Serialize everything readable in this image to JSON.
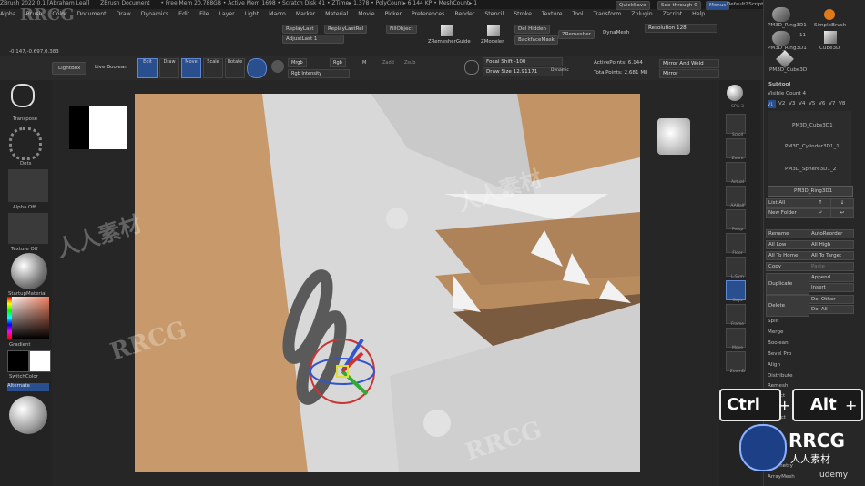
{
  "titlebar": {
    "app": "ZBrush 2022.0.1 [Abraham Leal]",
    "doc": "ZBrush Document",
    "stats": "• Free Mem 20.788GB • Active Mem 1698 • Scratch Disk 41 • ZTime▸ 1.378 • PolyCount▸ 6.144 KP • MeshCount▸ 1",
    "quicksave": "QuickSave",
    "seethrough": "See-through  0",
    "menus_label": "Menus",
    "default_script": "DefaultZScript"
  },
  "menubar": [
    "Alpha",
    "Brush",
    "Color",
    "Document",
    "Draw",
    "Dynamics",
    "Edit",
    "File",
    "Layer",
    "Light",
    "Macro",
    "Marker",
    "Material",
    "Movie",
    "Picker",
    "Preferences",
    "Render",
    "Stencil",
    "Stroke",
    "Texture",
    "Tool",
    "Transform",
    "Zplugin",
    "Zscript",
    "Help"
  ],
  "coords": "-0.147,-0.697,0.383",
  "top_buttons": {
    "replay_last": "ReplayLast",
    "replay_last_rel": "ReplayLastRel",
    "adjust_last": "AdjustLast 1",
    "fill_object": "FillObject",
    "zremesher_guide": "ZRemesherGuide",
    "zmodeler": "ZModeler",
    "del_hidden": "Del Hidden",
    "backface_mask": "BackfaceMask",
    "zremesher": "ZRemesher",
    "dynamesh": "DynaMesh",
    "resolution": "Resolution 128"
  },
  "toolbar": {
    "lightbox": "LightBox",
    "live_boolean": "Live Boolean",
    "edit": "Edit",
    "draw": "Draw",
    "move": "Move",
    "scale": "Scale",
    "rotate": "Rotate",
    "mrgb": "Mrgb",
    "rgb": "Rgb",
    "m": "M",
    "zadd": "Zadd",
    "zsub": "Zsub",
    "rgb_intensity": "Rgb Intensity",
    "focal_shift": "Focal Shift -100",
    "draw_size": "Draw Size 12.91171",
    "dynamic": "Dynamic",
    "active_points": "ActivePoints: 6.144",
    "total_points": "TotalPoints: 2.681 Mil",
    "mirror_and_weld": "Mirror And Weld",
    "mirror": "Mirror"
  },
  "left_panel": {
    "transpose": "Transpose",
    "dots": "Dots",
    "alpha_off": "Alpha Off",
    "texture_off": "Texture Off",
    "startup_material": "StartupMaterial",
    "gradient": "Gradient",
    "switch_color": "SwitchColor",
    "alternate": "Alternate"
  },
  "right_dock": {
    "spix": "SPix 3",
    "items": [
      "Scroll",
      "Zoom",
      "Actual",
      "AAHalf",
      "Persp",
      "Floor",
      "L.Sym",
      "Gxyz",
      "Frame",
      "Move",
      "ZoomD",
      "Rotate"
    ]
  },
  "tool_panel": {
    "thumbs": [
      "PM3D_Ring3D1",
      "SimpleBrush",
      "PM3D_Ring3D1",
      "Cube3D",
      "PM3D_Cube3D"
    ],
    "thumb_count": "11",
    "subtool": "Subtool",
    "visible_count": "Visible Count 4",
    "v_labels": [
      "V1",
      "V2",
      "V3",
      "V4",
      "V5",
      "V6",
      "V7",
      "V8"
    ],
    "subtools": [
      "PM3D_Cube3D1",
      "PM3D_Cylinder3D1_1",
      "PM3D_Sphere3D1_2",
      "PM3D_Ring3D1"
    ],
    "list_all": "List All",
    "new_folder": "New Folder",
    "rename": "Rename",
    "auto_reorder": "AutoReorder",
    "all_low": "All Low",
    "all_high": "All High",
    "all_to_home": "All To Home",
    "all_to_target": "All To Target",
    "copy": "Copy",
    "paste": "Paste",
    "duplicate": "Duplicate",
    "append": "Append",
    "insert": "Insert",
    "delete": "Delete",
    "del_other": "Del Other",
    "del_all": "Del All",
    "split": "Split",
    "merge": "Merge",
    "boolean": "Boolean",
    "bevel_pro": "Bevel Pro",
    "align": "Align",
    "distribute": "Distribute",
    "remesh": "Remesh",
    "project": "Project",
    "extract": "Extract",
    "geometry": "Geometry",
    "array_mesh": "ArrayMesh"
  },
  "overlay": {
    "ctrl": "Ctrl",
    "alt": "Alt",
    "plus": "+",
    "watermark": "RRCG",
    "watermark_cn": "人人素材",
    "udemy": "udemy"
  }
}
